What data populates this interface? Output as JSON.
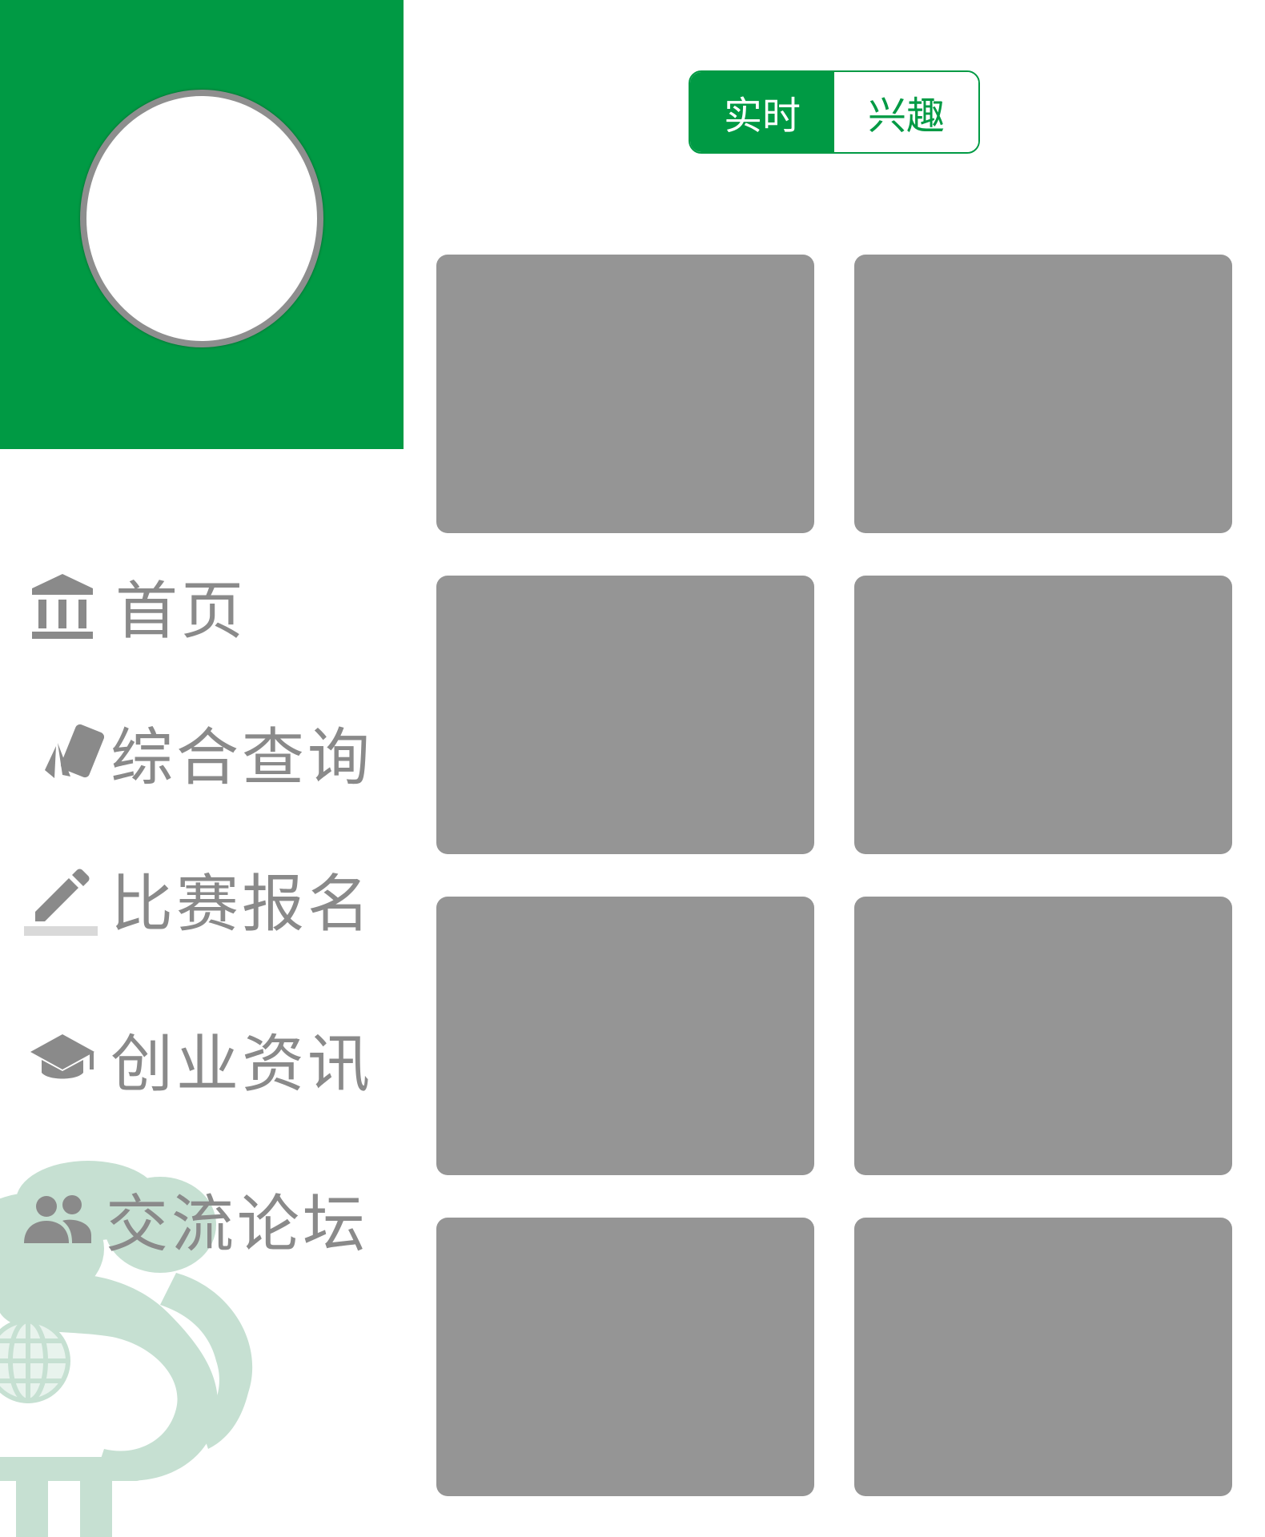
{
  "sidebar": {
    "menu": [
      {
        "label": "首页",
        "icon": "bank-icon"
      },
      {
        "label": "综合查询",
        "icon": "cards-icon"
      },
      {
        "label": "比赛报名",
        "icon": "pencil-icon"
      },
      {
        "label": "创业资讯",
        "icon": "graduation-cap-icon"
      },
      {
        "label": "交流论坛",
        "icon": "people-icon"
      }
    ]
  },
  "toggle": {
    "options": [
      "实时",
      "兴趣"
    ],
    "selected": "实时"
  },
  "colors": {
    "brand_green": "#009a44",
    "placeholder_gray": "#959595",
    "menu_text": "#8a8a8a",
    "watermark": "#c6e0d2"
  },
  "grid": {
    "card_count": 8
  }
}
